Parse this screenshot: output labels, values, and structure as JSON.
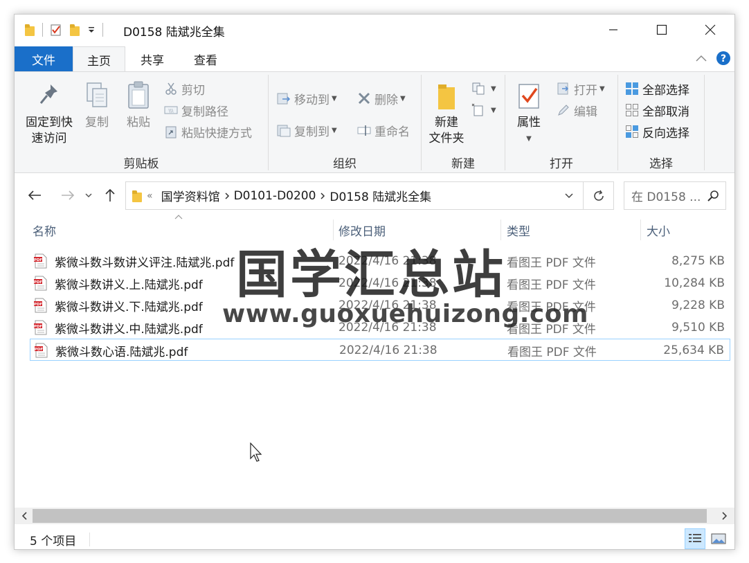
{
  "window": {
    "title": "D0158 陆斌兆全集"
  },
  "ribbon_tabs": [
    {
      "label": "文件"
    },
    {
      "label": "主页"
    },
    {
      "label": "共享"
    },
    {
      "label": "查看"
    }
  ],
  "ribbon": {
    "clipboard": {
      "label": "剪贴板",
      "pin_line1": "固定到快",
      "pin_line2": "速访问",
      "copy": "复制",
      "paste": "粘贴",
      "cut": "剪切",
      "copy_path": "复制路径",
      "paste_shortcut": "粘贴快捷方式"
    },
    "organize": {
      "label": "组织",
      "move_to": "移动到",
      "copy_to": "复制到",
      "delete": "删除",
      "rename": "重命名"
    },
    "new": {
      "label": "新建",
      "new_folder_line1": "新建",
      "new_folder_line2": "文件夹"
    },
    "open": {
      "label": "打开",
      "properties": "属性",
      "open": "打开",
      "edit": "编辑"
    },
    "select": {
      "label": "选择",
      "select_all": "全部选择",
      "select_none": "全部取消",
      "invert": "反向选择"
    }
  },
  "address": {
    "prefix": "«",
    "crumbs": [
      "国学资料馆",
      "D0101-D0200",
      "D0158 陆斌兆全集"
    ],
    "search_placeholder": "在 D0158 ..."
  },
  "columns": {
    "name": "名称",
    "date": "修改日期",
    "type": "类型",
    "size": "大小"
  },
  "files": [
    {
      "name": "紫微斗数斗数讲义评注.陆斌兆.pdf",
      "date": "2022/4/16 21:38",
      "type": "看图王 PDF 文件",
      "size": "8,275 KB"
    },
    {
      "name": "紫微斗数讲义.上.陆斌兆.pdf",
      "date": "2022/4/16 21:38",
      "type": "看图王 PDF 文件",
      "size": "10,284 KB"
    },
    {
      "name": "紫微斗数讲义.下.陆斌兆.pdf",
      "date": "2022/4/16 21:38",
      "type": "看图王 PDF 文件",
      "size": "9,228 KB"
    },
    {
      "name": "紫微斗数讲义.中.陆斌兆.pdf",
      "date": "2022/4/16 21:38",
      "type": "看图王 PDF 文件",
      "size": "9,510 KB"
    },
    {
      "name": "紫微斗数心语.陆斌兆.pdf",
      "date": "2022/4/16 21:38",
      "type": "看图王 PDF 文件",
      "size": "25,634 KB"
    }
  ],
  "watermark": {
    "line1": "国学汇总站",
    "line2": "www.guoxuehuizong.com"
  },
  "status": {
    "item_count": "5 个项目"
  }
}
